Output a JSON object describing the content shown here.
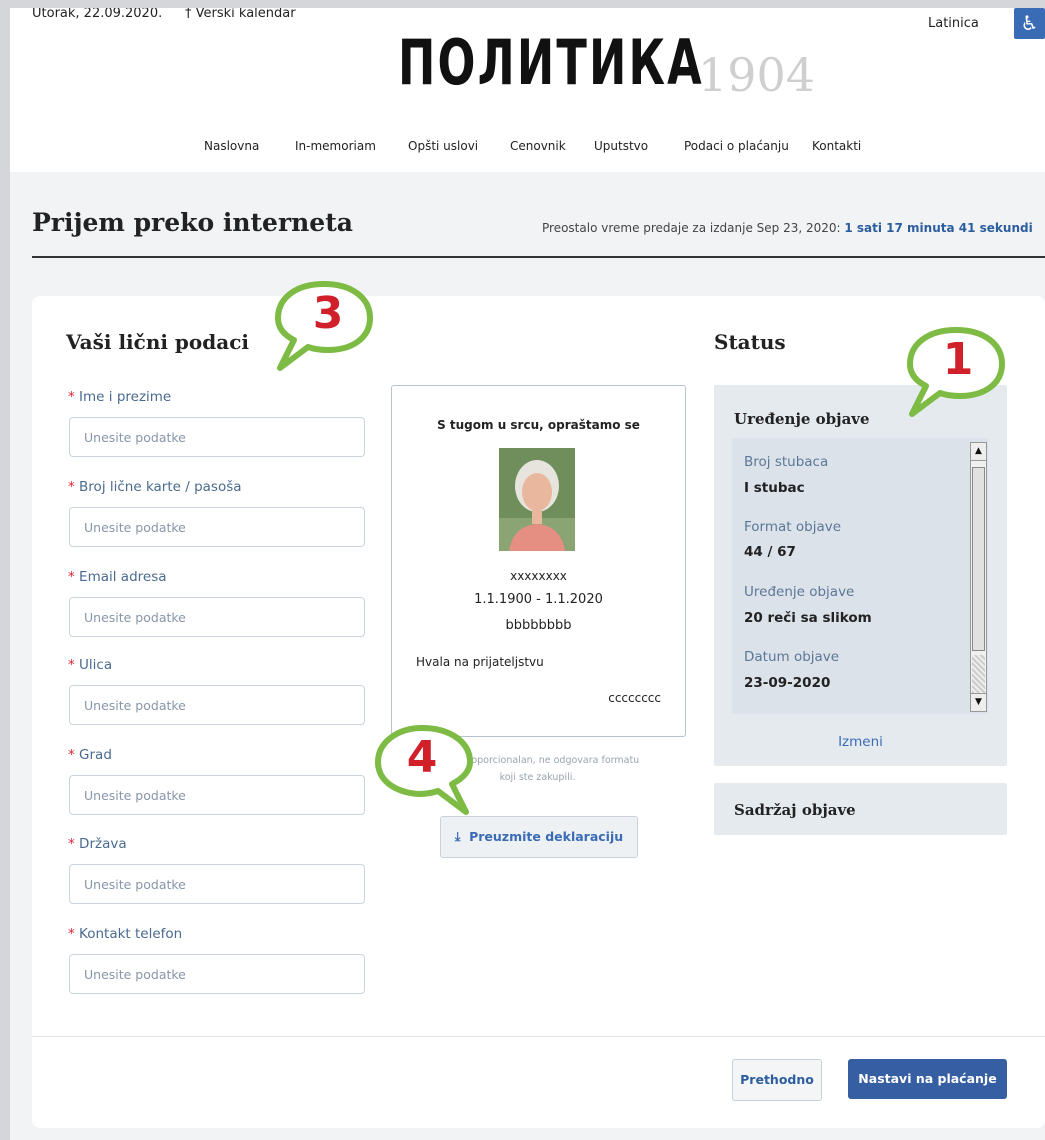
{
  "header": {
    "date": "Utorak, 22.09.2020.",
    "calendar_link": "† Verski kalendar",
    "script_toggle": "Latinica",
    "accessibility_icon": "wheelchair-icon",
    "logo_text": "ПОЛИТИКА",
    "logo_year": "1904"
  },
  "nav": {
    "items": [
      "Naslovna",
      "In-memoriam",
      "Opšti uslovi",
      "Cenovnik",
      "Uputstvo",
      "Podaci o plaćanju",
      "Kontakti"
    ]
  },
  "page": {
    "title": "Prijem preko interneta",
    "deadline_text": "Preostalo vreme predaje za izdanje Sep 23, 2020: ",
    "deadline_value": "1 sati 17 minuta 41 sekundi"
  },
  "form": {
    "title": "Vaši lični podaci",
    "placeholder": "Unesite podatke",
    "fields": [
      {
        "label": "Ime i prezime"
      },
      {
        "label": "Broj lične karte / pasoša"
      },
      {
        "label": "Email adresa"
      },
      {
        "label": "Ulica"
      },
      {
        "label": "Grad"
      },
      {
        "label": "Država"
      },
      {
        "label": "Kontakt telefon"
      }
    ]
  },
  "preview": {
    "heading": "S tugom u srcu, opraštamo se",
    "name": "xxxxxxxx",
    "dates": "1.1.1900 - 1.1.2020",
    "line3": "bbbbbbbb",
    "thanks": "Hvala na prijateljstvu",
    "signature": "cccccccc",
    "note_line1": "elni i proporcionalan, ne odgovara formatu",
    "note_line2": "koji ste zakupili.",
    "download_label": "Preuzmite deklaraciju",
    "download_icon": "download-icon"
  },
  "status": {
    "title": "Status",
    "box_title": "Uređenje objave",
    "items": [
      {
        "label": "Broj stubaca",
        "value": "I stubac"
      },
      {
        "label": "Format objave",
        "value": "44 / 67"
      },
      {
        "label": "Uređenje objave",
        "value": "20 reči sa slikom"
      },
      {
        "label": "Datum objave",
        "value": "23-09-2020"
      }
    ],
    "edit_label": "Izmeni",
    "content_title": "Sadržaj objave"
  },
  "footer": {
    "prev_label": "Prethodno",
    "next_label": "Nastavi na plaćanje"
  },
  "callouts": {
    "one": "1",
    "three": "3",
    "four": "4",
    "bubble_color": "#7dbb44"
  }
}
